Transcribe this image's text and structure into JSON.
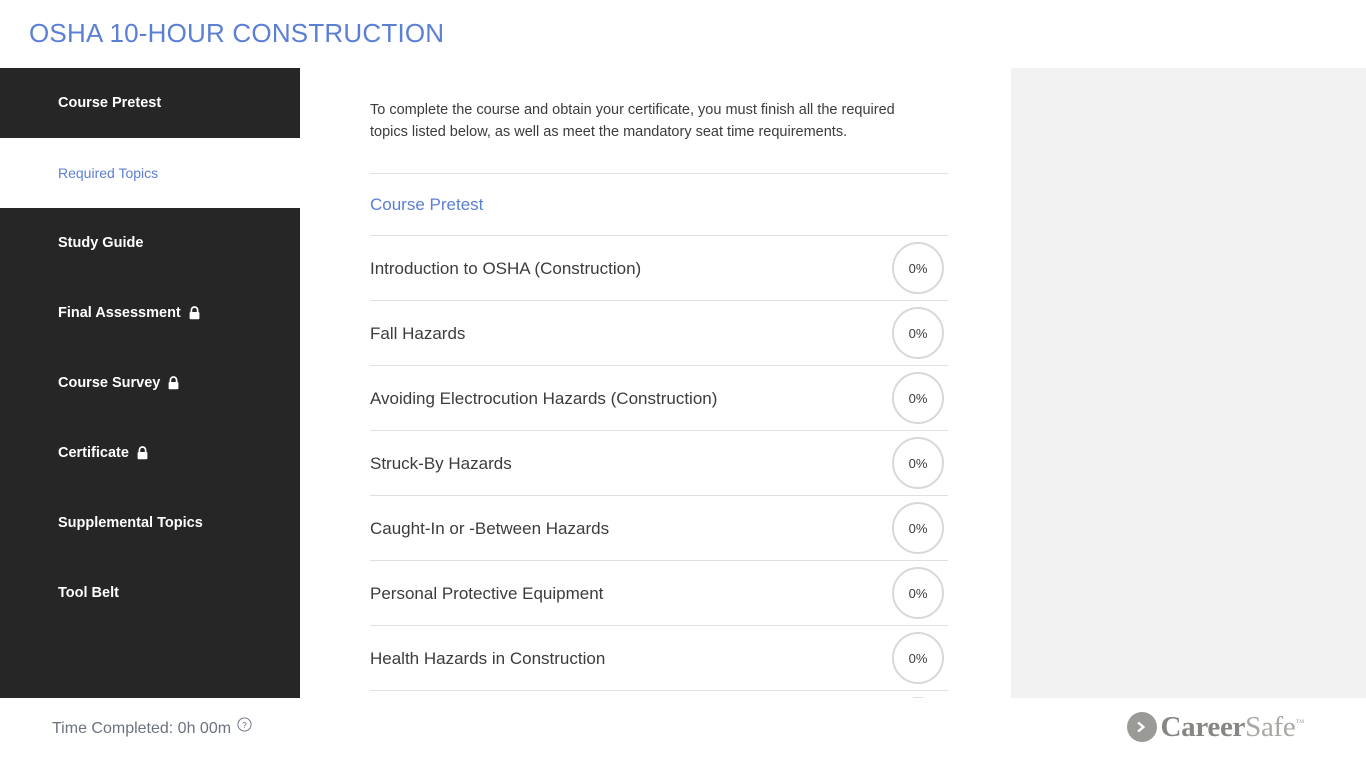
{
  "header": {
    "title": "OSHA 10-HOUR CONSTRUCTION",
    "title_color": "#5b7fd4"
  },
  "sidebar": {
    "background_color": "#262626",
    "active_color": "#5b7fd4",
    "items": [
      {
        "label": "Course Pretest",
        "locked": false,
        "active": false
      },
      {
        "label": "Required Topics",
        "locked": false,
        "active": true
      },
      {
        "label": "Study Guide",
        "locked": false,
        "active": false
      },
      {
        "label": "Final Assessment",
        "locked": true,
        "active": false
      },
      {
        "label": "Course Survey",
        "locked": true,
        "active": false
      },
      {
        "label": "Certificate",
        "locked": true,
        "active": false
      },
      {
        "label": "Supplemental Topics",
        "locked": false,
        "active": false
      },
      {
        "label": "Tool Belt",
        "locked": false,
        "active": false
      }
    ]
  },
  "main": {
    "intro": "To complete the course and obtain your certificate, you must finish all the required topics listed below, as well as meet the mandatory seat time requirements.",
    "pretest_link": "Course Pretest",
    "topics": [
      {
        "title": "Introduction to OSHA (Construction)",
        "progress": "0%"
      },
      {
        "title": "Fall Hazards",
        "progress": "0%"
      },
      {
        "title": "Avoiding Electrocution Hazards (Construction)",
        "progress": "0%"
      },
      {
        "title": "Struck-By Hazards",
        "progress": "0%"
      },
      {
        "title": "Caught-In or -Between Hazards",
        "progress": "0%"
      },
      {
        "title": "Personal Protective Equipment",
        "progress": "0%"
      },
      {
        "title": "Health Hazards in Construction",
        "progress": "0%"
      }
    ]
  },
  "footer": {
    "time_completed": "Time Completed: 0h 00m",
    "help_icon": "help-circle-icon",
    "logo": {
      "mark_icon": "chevron-right-circle-icon",
      "name_bold": "Career",
      "name_light": "Safe",
      "trademark": "™"
    }
  }
}
